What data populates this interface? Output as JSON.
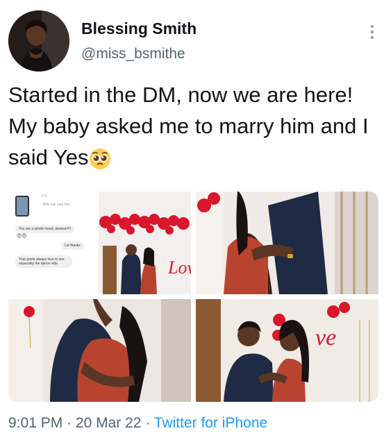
{
  "user": {
    "name": "Blessing Smith",
    "handle": "@miss_bsmithe"
  },
  "tweet": {
    "text": "Started in the DM, now we are here! My baby asked me to marry him and I said Yes",
    "emoji": "pleading-face"
  },
  "media": {
    "dm_screenshot": {
      "caption": "Billy has sent this",
      "msg1": "You are a whole mood, awwww!!!!",
      "msg2": "Lol thanks",
      "msg3": "Your posts always nice to see especially the dance vids",
      "balloon_sign": "Love"
    }
  },
  "meta": {
    "time": "9:01 PM",
    "separator1": "·",
    "date": "20 Mar 22",
    "separator2": "·",
    "source": "Twitter for iPhone"
  },
  "colors": {
    "link": "#1d9bf0",
    "secondary_text": "#536471",
    "dress": "#b8442f",
    "balloons": "#d8162c"
  }
}
